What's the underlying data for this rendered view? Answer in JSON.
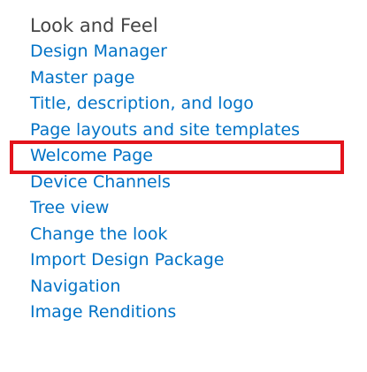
{
  "section": {
    "title": "Look and Feel"
  },
  "links": [
    {
      "label": "Design Manager"
    },
    {
      "label": "Master page"
    },
    {
      "label": "Title, description, and logo"
    },
    {
      "label": "Page layouts and site templates",
      "highlighted": true
    },
    {
      "label": "Welcome Page"
    },
    {
      "label": "Device Channels"
    },
    {
      "label": "Tree view"
    },
    {
      "label": "Change the look"
    },
    {
      "label": "Import Design Package"
    },
    {
      "label": "Navigation"
    },
    {
      "label": "Image Renditions"
    }
  ],
  "colors": {
    "title": "#444444",
    "link": "#0072c6",
    "highlight_border": "#e3131b"
  }
}
